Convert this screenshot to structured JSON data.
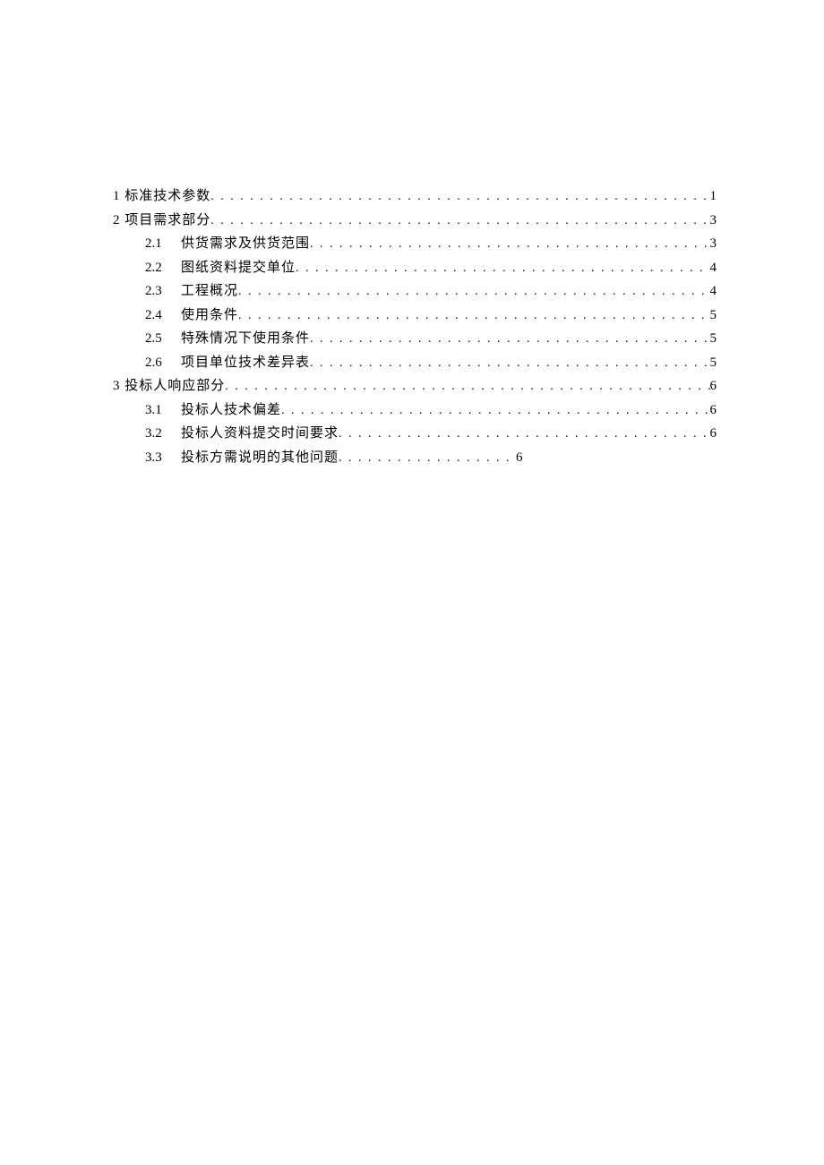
{
  "toc": [
    {
      "level": 1,
      "num": "1",
      "title": "标准技术参数",
      "page": "1",
      "short": false
    },
    {
      "level": 1,
      "num": "2",
      "title": "项目需求部分",
      "page": "3",
      "short": false
    },
    {
      "level": 2,
      "num": "2.1",
      "title": "供货需求及供货范围",
      "page": "3",
      "short": false
    },
    {
      "level": 2,
      "num": "2.2",
      "title": "图纸资料提交单位",
      "page": "4",
      "short": false
    },
    {
      "level": 2,
      "num": "2.3",
      "title": "工程概况",
      "page": "4",
      "short": false
    },
    {
      "level": 2,
      "num": "2.4",
      "title": "使用条件",
      "page": "5",
      "short": false
    },
    {
      "level": 2,
      "num": "2.5",
      "title": "特殊情况下使用条件",
      "page": "5",
      "short": false
    },
    {
      "level": 2,
      "num": "2.6",
      "title": "项目单位技术差异表",
      "page": "5",
      "short": false
    },
    {
      "level": 1,
      "num": "3",
      "title": "投标人响应部分",
      "page": "6",
      "short": false
    },
    {
      "level": 2,
      "num": "3.1",
      "title": "投标人技术偏差",
      "page": "6",
      "short": false
    },
    {
      "level": 2,
      "num": "3.2",
      "title": "投标人资料提交时间要求",
      "page": "6",
      "short": false
    },
    {
      "level": 2,
      "num": "3.3",
      "title": "投标方需说明的其他问题",
      "page": "6",
      "short": true
    }
  ]
}
